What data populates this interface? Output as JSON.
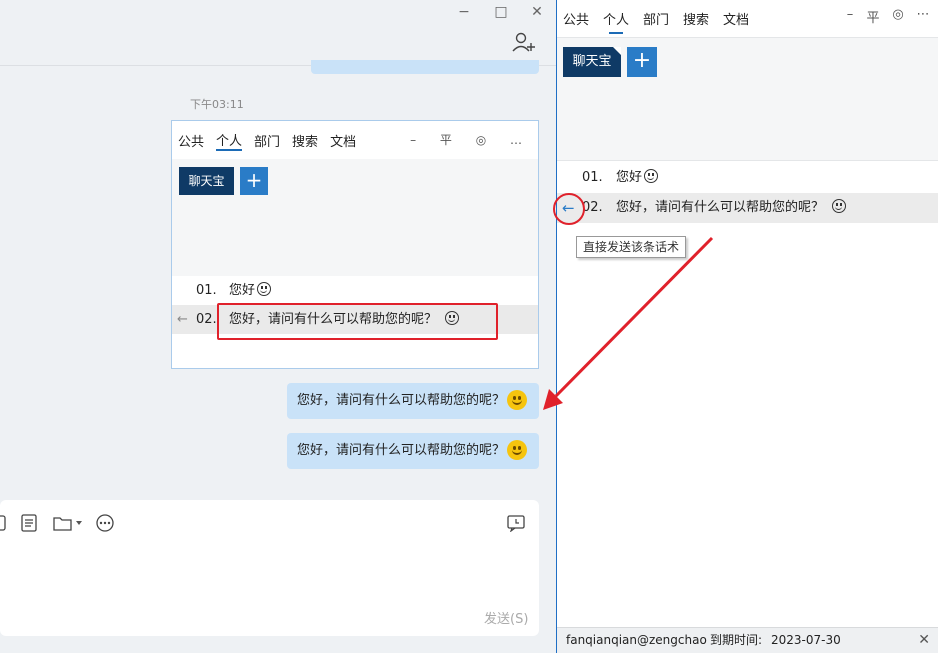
{
  "chat": {
    "window_controls": {
      "minimize": "−",
      "maximize": "□",
      "close": "✕"
    },
    "timestamp": "下午03:11",
    "messages": [
      {
        "text": "您好，请问有什么可以帮助您的呢？",
        "emoji": "smiley"
      },
      {
        "text": "您好，请问有什么可以帮助您的呢？",
        "emoji": "smiley"
      }
    ],
    "composer": {
      "send_label": "发送(S)",
      "tools": [
        "document-icon",
        "folder-icon",
        "more-icon",
        "history-icon"
      ]
    }
  },
  "embedded_panel": {
    "tabs": [
      "公共",
      "个人",
      "部门",
      "搜索",
      "文档"
    ],
    "active_tab": "个人",
    "tools": "– 平 ◎ …",
    "category_label": "聊天宝",
    "add_label": "+",
    "send_arrow": "←",
    "rows": [
      {
        "num": "01.",
        "text": "您好"
      },
      {
        "num": "02.",
        "text": "您好，请问有什么可以帮助您的呢？"
      }
    ]
  },
  "quick_reply": {
    "tabs": [
      "公共",
      "个人",
      "部门",
      "搜索",
      "文档"
    ],
    "active_tab": "个人",
    "tools": {
      "minimize": "–",
      "pin": "平",
      "settings": "◎",
      "more": "⋯"
    },
    "category_label": "聊天宝",
    "add_label": "+",
    "send_arrow": "←",
    "rows": [
      {
        "num": "01.",
        "text": "您好"
      },
      {
        "num": "02.",
        "text": "您好，请问有什么可以帮助您的呢？"
      }
    ],
    "tooltip": "直接发送该条话术",
    "footer": {
      "account": "fanqianqian@zengchao",
      "expiry_label": "到期时间:",
      "expiry_date": "2023-07-30",
      "close": "✕"
    }
  },
  "colors": {
    "accent": "#1c6bb6",
    "category_bg": "#0f3a66",
    "bubble_bg": "#c9e2f8",
    "annotation_red": "#e0212b"
  }
}
